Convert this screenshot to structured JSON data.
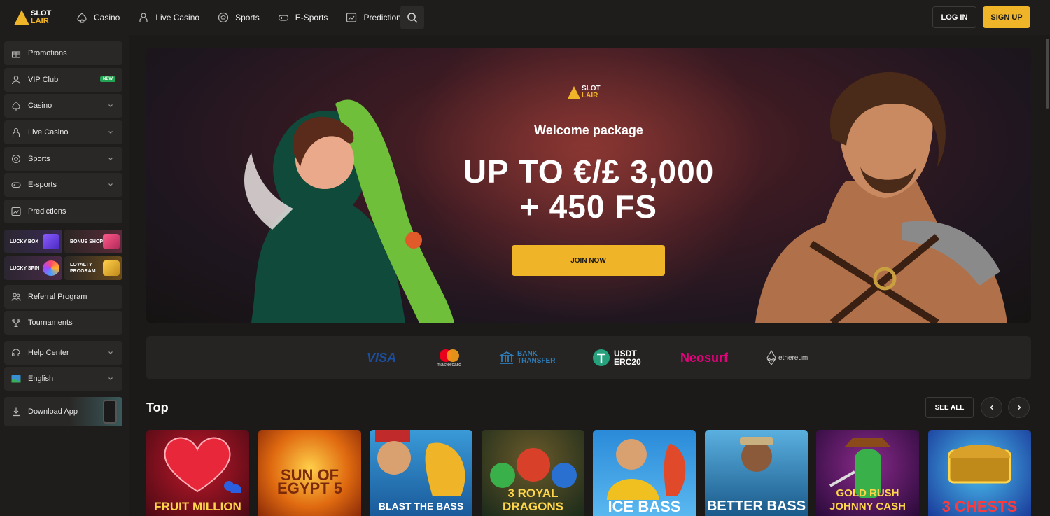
{
  "brand": {
    "line1": "SLOT",
    "line2": "LAIR",
    "accent": "#f0b429"
  },
  "nav": [
    {
      "label": "Casino",
      "icon": "spade-icon"
    },
    {
      "label": "Live Casino",
      "icon": "dealer-icon"
    },
    {
      "label": "Sports",
      "icon": "soccer-ball-icon"
    },
    {
      "label": "E-Sports",
      "icon": "gamepad-icon"
    },
    {
      "label": "Predictions",
      "icon": "chart-icon"
    }
  ],
  "header": {
    "login": "LOG IN",
    "signup": "SIGN UP"
  },
  "sidebar": {
    "items": [
      {
        "label": "Promotions"
      },
      {
        "label": "VIP Club",
        "badge": "NEW"
      },
      {
        "label": "Casino"
      },
      {
        "label": "Live Casino"
      },
      {
        "label": "Sports"
      },
      {
        "label": "E-sports"
      },
      {
        "label": "Predictions"
      }
    ],
    "tiles": [
      {
        "label": "LUCKY BOX"
      },
      {
        "label": "BONUS SHOP"
      },
      {
        "label": "LUCKY SPIN"
      },
      {
        "label": "LOYALTY PROGRAM"
      }
    ],
    "bottom": [
      {
        "label": "Referral Program"
      },
      {
        "label": "Tournaments"
      },
      {
        "label": "Help Center"
      },
      {
        "label": "English"
      },
      {
        "label": "Download App"
      }
    ]
  },
  "hero": {
    "logo1": "SLOT",
    "logo2": "LAIR",
    "subtitle": "Welcome package",
    "title_line1": "UP TO €/£ 3,000",
    "title_line2": "+ 450 FS",
    "cta": "JOIN NOW"
  },
  "payments": [
    {
      "label": "VISA",
      "color": "#1a4fa0"
    },
    {
      "label": "mastercard",
      "color": "#eb001b"
    },
    {
      "label": "BANK TRANSFER",
      "color": "#2f7db8"
    },
    {
      "label": "USDT ERC20",
      "color": "#26a17b"
    },
    {
      "label": "Neosurf",
      "color": "#e6007e"
    },
    {
      "label": "ethereum",
      "color": "#cfcfcf"
    }
  ],
  "top_section": {
    "title": "Top",
    "see_all": "SEE ALL"
  },
  "games": [
    {
      "name": "FRUIT MILLION"
    },
    {
      "name": "SUN OF EGYPT 5"
    },
    {
      "name": "BLAST THE BASS"
    },
    {
      "name": "3 ROYAL DRAGONS"
    },
    {
      "name": "ICE BASS"
    },
    {
      "name": "BETTER BASS"
    },
    {
      "name": "GOLD RUSH JOHNNY CASH"
    },
    {
      "name": "3 CHESTS"
    }
  ]
}
